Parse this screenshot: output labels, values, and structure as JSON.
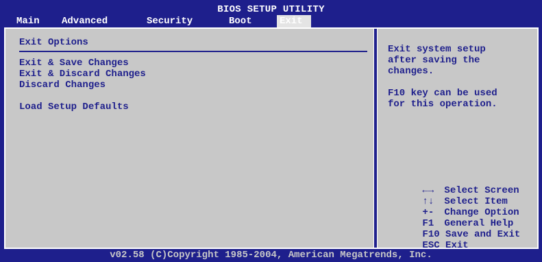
{
  "header": {
    "title": "BIOS SETUP UTILITY",
    "tabs": [
      {
        "label": "Main"
      },
      {
        "label": "Advanced"
      },
      {
        "label": "Security"
      },
      {
        "label": "Boot"
      },
      {
        "label": "Exit",
        "active": true
      }
    ]
  },
  "left": {
    "section_title": "Exit Options",
    "items": [
      {
        "label": "Exit & Save Changes"
      },
      {
        "label": "Exit & Discard Changes"
      },
      {
        "label": "Discard Changes"
      },
      {
        "label": "Load Setup Defaults"
      }
    ]
  },
  "help": {
    "lines": [
      "Exit system setup",
      "after saving the",
      "changes.",
      "F10 key can be used",
      "for this operation."
    ]
  },
  "keys": [
    {
      "key": "←→",
      "label": "Select Screen"
    },
    {
      "key": "↑↓",
      "label": "Select Item"
    },
    {
      "key": "+-",
      "label": "Change Option"
    },
    {
      "key": "F1",
      "label": "General Help"
    },
    {
      "key": "F10",
      "label": "Save and Exit"
    },
    {
      "key": "ESC",
      "label": "Exit"
    }
  ],
  "footer": {
    "copyright": "v02.58 (C)Copyright 1985-2004, American Megatrends, Inc."
  },
  "colors": {
    "background": "#1e1f8c",
    "panel": "#c8c8c8",
    "text": "#1e1f8c",
    "highlight": "#ffffff"
  }
}
